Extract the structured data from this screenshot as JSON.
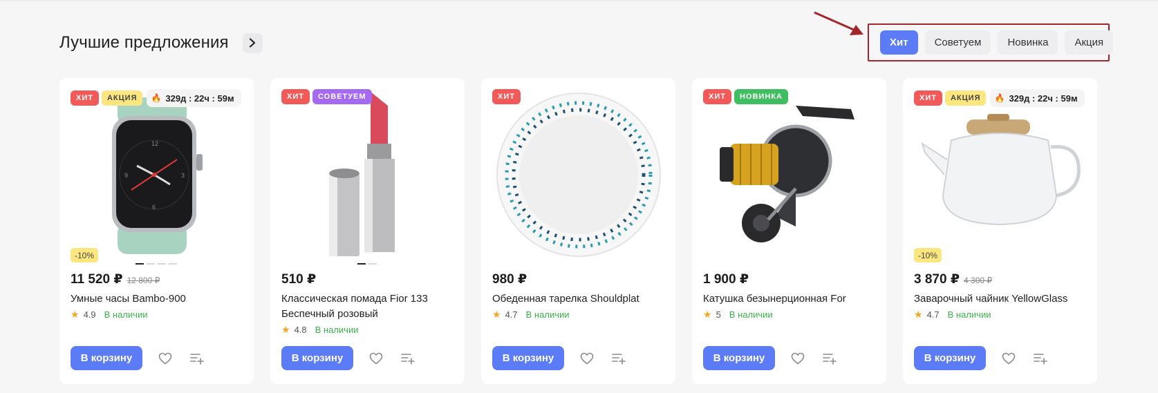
{
  "section": {
    "title": "Лучшие предложения",
    "more_icon": "chevron-right-icon"
  },
  "tabs": [
    {
      "label": "Хит",
      "active": true
    },
    {
      "label": "Советуем",
      "active": false
    },
    {
      "label": "Новинка",
      "active": false
    },
    {
      "label": "Акция",
      "active": false
    }
  ],
  "colors": {
    "accent": "#5b7cf6",
    "hit": "#f25a5a",
    "sale": "#fbe67f",
    "recommend": "#a66af0",
    "new": "#3fbf61",
    "in_stock": "#3bb34a",
    "annotation": "#a3262b"
  },
  "products": [
    {
      "badges": [
        "ХИТ",
        "АКЦИЯ"
      ],
      "timer": "329д : 22ч : 59м",
      "discount": "-10%",
      "price": "11 520 ₽",
      "old_price": "12 800 ₽",
      "name": "Умные часы Bambo-900",
      "rating": "4.9",
      "stock": "В наличии",
      "cart_label": "В корзину",
      "image": "smartwatch"
    },
    {
      "badges": [
        "ХИТ",
        "СОВЕТУЕМ"
      ],
      "price": "510 ₽",
      "name": "Классическая помада Fior 133 Беспечный розовый",
      "rating": "4.8",
      "stock": "В наличии",
      "cart_label": "В корзину",
      "image": "lipstick"
    },
    {
      "badges": [
        "ХИТ"
      ],
      "price": "980 ₽",
      "name": "Обеденная тарелка Shouldplat",
      "rating": "4.7",
      "stock": "В наличии",
      "cart_label": "В корзину",
      "image": "plate"
    },
    {
      "badges": [
        "ХИТ",
        "НОВИНКА"
      ],
      "price": "1 900 ₽",
      "name": "Катушка безынерционная For",
      "rating": "5",
      "stock": "В наличии",
      "cart_label": "В корзину",
      "image": "fishing-reel"
    },
    {
      "badges": [
        "ХИТ",
        "АКЦИЯ"
      ],
      "timer": "329д : 22ч : 59м",
      "discount": "-10%",
      "price": "3 870 ₽",
      "old_price": "4 300 ₽",
      "name": "Заварочный чайник YellowGlass",
      "rating": "4.7",
      "stock": "В наличии",
      "cart_label": "В корзину",
      "image": "teapot"
    }
  ]
}
